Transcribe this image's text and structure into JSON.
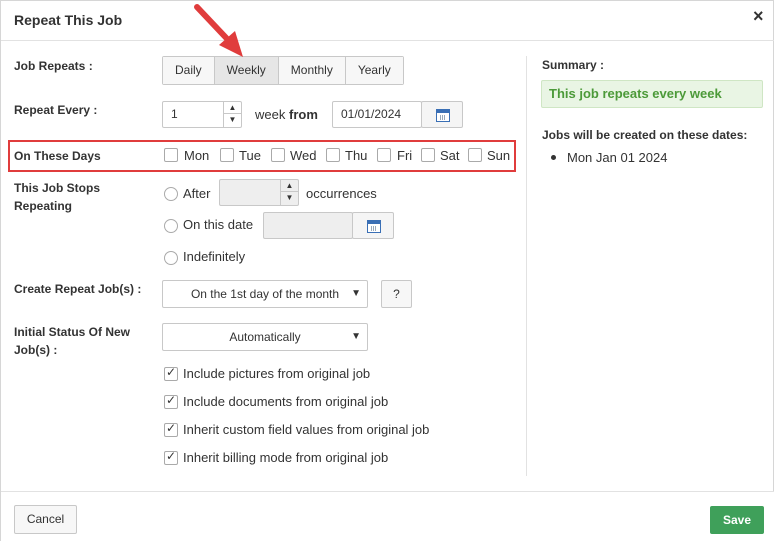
{
  "dialog": {
    "title": "Repeat This Job",
    "close_glyph": "×"
  },
  "labels": {
    "job_repeats": "Job Repeats :",
    "repeat_every": "Repeat Every :",
    "on_these_days": "On These Days",
    "stops_line1": "This Job Stops",
    "stops_line2": "Repeating",
    "create_repeat": "Create Repeat Job(s) :",
    "initial_status_line1": "Initial Status Of New",
    "initial_status_line2": "Job(s) :"
  },
  "repeat_tabs": [
    {
      "label": "Daily",
      "active": false
    },
    {
      "label": "Weekly",
      "active": true
    },
    {
      "label": "Monthly",
      "active": false
    },
    {
      "label": "Yearly",
      "active": false
    }
  ],
  "repeat_every": {
    "value": "1",
    "unit_text": "week",
    "from_text": "from",
    "date": "01/01/2024"
  },
  "days": [
    {
      "label": "Mon",
      "checked": false
    },
    {
      "label": "Tue",
      "checked": false
    },
    {
      "label": "Wed",
      "checked": false
    },
    {
      "label": "Thu",
      "checked": false
    },
    {
      "label": "Fri",
      "checked": false
    },
    {
      "label": "Sat",
      "checked": false
    },
    {
      "label": "Sun",
      "checked": false
    }
  ],
  "stops": {
    "after_label": "After",
    "occurrences_label": "occurrences",
    "after_value": "",
    "on_date_label": "On this date",
    "on_date_value": "",
    "indefinitely_label": "Indefinitely"
  },
  "create_repeat_select": "On the 1st day of the month",
  "help_label": "?",
  "initial_status_select": "Automatically",
  "options": [
    {
      "label": "Include pictures from original job",
      "checked": true
    },
    {
      "label": "Include documents from original job",
      "checked": true
    },
    {
      "label": "Inherit custom field values from original job",
      "checked": true
    },
    {
      "label": "Inherit billing mode from original job",
      "checked": true
    }
  ],
  "summary": {
    "heading": "Summary :",
    "text": "This job repeats every week",
    "dates_heading": "Jobs will be created on these dates:",
    "dates": [
      "Mon Jan 01 2024"
    ]
  },
  "footer": {
    "cancel_label": "Cancel",
    "save_label": "Save"
  },
  "colors": {
    "save_green": "#3fa05a",
    "summary_green": "#4c9a39",
    "highlight_red": "#e03c3c"
  }
}
